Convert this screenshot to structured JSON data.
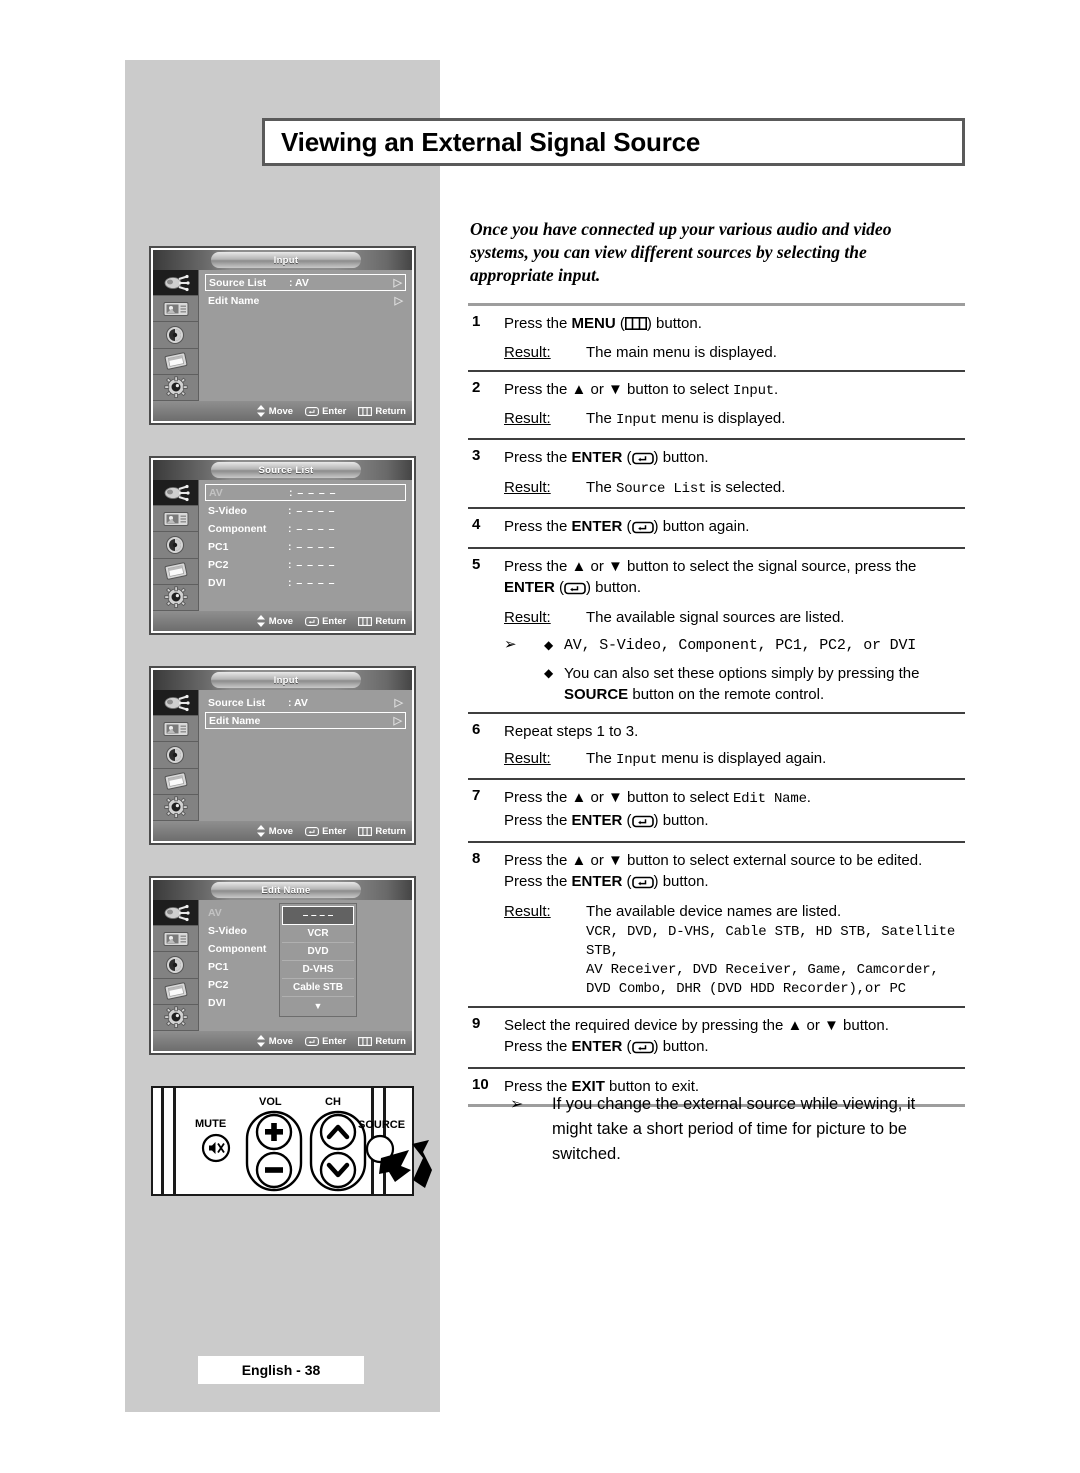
{
  "page": {
    "title": "Viewing an External Signal Source",
    "intro": "Once you have connected up your various audio and video systems, you can view different sources by selecting the appropriate input.",
    "footer": "English - 38"
  },
  "steps": [
    {
      "num": "1",
      "text_a": "Press the ",
      "bold_a": "MENU",
      "text_b": " (",
      "icon": "menu-icon",
      "text_c": ") button.",
      "result_label": "Result:",
      "result_text": "The main menu is displayed."
    },
    {
      "num": "2",
      "text_a": "Press the ▲ or ▼ button to select ",
      "mono_a": "Input",
      "text_c": ".",
      "result_label": "Result:",
      "result_pre": "The ",
      "result_mono": "Input",
      "result_post": " menu is displayed."
    },
    {
      "num": "3",
      "text_a": "Press the ",
      "bold_a": "ENTER",
      "text_b": " (",
      "icon": "enter-icon",
      "text_c": ") button.",
      "result_label": "Result:",
      "result_pre": "The ",
      "result_mono": "Source List",
      "result_post": " is selected."
    },
    {
      "num": "4",
      "text_a": "Press the ",
      "bold_a": "ENTER",
      "text_b": " (",
      "icon": "enter-icon",
      "text_c": ") button again."
    },
    {
      "num": "5",
      "text_a": "Press the ▲ or ▼ button to select the signal source, press the ",
      "bold_a": "ENTER",
      "text_b": " (",
      "icon": "enter-icon",
      "text_c": ") button.",
      "result_label": "Result:",
      "result_text": "The available signal sources are listed.",
      "bullets": [
        {
          "arrow": "➢",
          "diamond": "◆",
          "mono": "AV, S-Video, Component, PC1, PC2, or DVI"
        },
        {
          "arrow": "",
          "diamond": "◆",
          "text_pre": "You can also set these options simply by pressing the ",
          "bold": "SOURCE",
          "text_post": " button on the remote control."
        }
      ]
    },
    {
      "num": "6",
      "text_a": "Repeat steps 1 to 3.",
      "result_label": "Result:",
      "result_pre": "The ",
      "result_mono": "Input",
      "result_post": " menu is displayed again."
    },
    {
      "num": "7",
      "text_a": "Press the ▲ or ▼ button to select ",
      "mono_a": "Edit Name",
      "text_c": ".",
      "line2_a": "Press the ",
      "line2_bold": "ENTER",
      "line2_b": " (",
      "line2_icon": "enter-icon",
      "line2_c": ") button."
    },
    {
      "num": "8",
      "text_a": "Press the ▲ or ▼ button to select external source to be edited.",
      "line2_a": "Press the ",
      "line2_bold": "ENTER",
      "line2_b": " (",
      "line2_icon": "enter-icon",
      "line2_c": ") button.",
      "result_label": "Result:",
      "result_text": "The available device names are listed.",
      "device_lines": [
        "VCR, DVD, D-VHS, Cable STB, HD STB, Satellite STB,",
        "AV Receiver, DVD Receiver, Game, Camcorder,",
        "DVD Combo, DHR (DVD HDD Recorder),or PC"
      ]
    },
    {
      "num": "9",
      "text_a": "Select the required device by pressing the ▲ or ▼ button.",
      "line2_a": "Press the ",
      "line2_bold": "ENTER",
      "line2_b": " (",
      "line2_icon": "enter-icon",
      "line2_c": ") button."
    },
    {
      "num": "10",
      "text_a": "Press the ",
      "bold_a": "EXIT",
      "text_c": " button to exit."
    }
  ],
  "note": {
    "arrow": "➢",
    "text": "If you change the external source while viewing, it might take a short period of time for picture to be switched."
  },
  "osd_footer": {
    "move": "Move",
    "enter": "Enter",
    "return": "Return"
  },
  "osd_icons": [
    "input-plug-icon",
    "picture-icon",
    "sound-speaker-icon",
    "channel-icon",
    "setup-gear-icon"
  ],
  "osd1": {
    "title": "Input",
    "rows": [
      {
        "label": "Source List",
        "value": ": AV",
        "caret": "▷",
        "selected": true
      },
      {
        "label": "Edit Name",
        "value": "",
        "caret": "▷",
        "selected": false
      }
    ]
  },
  "osd2": {
    "title": "Source List",
    "rows": [
      {
        "label": "AV",
        "value": ": – – – –",
        "selected": true,
        "dim": true
      },
      {
        "label": "S-Video",
        "value": ": – – – –",
        "selected": false
      },
      {
        "label": "Component",
        "value": ": – – – –",
        "selected": false
      },
      {
        "label": "PC1",
        "value": ": – – – –",
        "selected": false
      },
      {
        "label": "PC2",
        "value": ": – – – –",
        "selected": false
      },
      {
        "label": "DVI",
        "value": ": – – – –",
        "selected": false
      }
    ]
  },
  "osd3": {
    "title": "Input",
    "rows": [
      {
        "label": "Source List",
        "value": ": AV",
        "caret": "▷",
        "selected": false
      },
      {
        "label": "Edit Name",
        "value": "",
        "caret": "▷",
        "selected": true
      }
    ]
  },
  "osd4": {
    "title": "Edit Name",
    "rows": [
      {
        "label": "AV",
        "value": ":",
        "dim": true
      },
      {
        "label": "S-Video",
        "value": ":"
      },
      {
        "label": "Component",
        "value": ":"
      },
      {
        "label": "PC1",
        "value": ":"
      },
      {
        "label": "PC2",
        "value": ":"
      },
      {
        "label": "DVI",
        "value": ":"
      }
    ],
    "dropdown": [
      {
        "label": "– – – –",
        "selected": true
      },
      {
        "label": "VCR",
        "selected": false
      },
      {
        "label": "DVD",
        "selected": false
      },
      {
        "label": "D-VHS",
        "selected": false
      },
      {
        "label": "Cable STB",
        "selected": false
      },
      {
        "label": "▼",
        "selected": false,
        "arrow": true
      }
    ]
  },
  "remote": {
    "mute_label": "MUTE",
    "vol_label": "VOL",
    "ch_label": "CH",
    "source_label": "SOURCE",
    "mute_icon": "mute-speaker-icon",
    "vol_up_icon": "plus-icon",
    "vol_down_icon": "minus-icon",
    "ch_up_icon": "chevron-up-icon",
    "ch_down_icon": "chevron-down-icon",
    "source_icon": "source-button-icon",
    "pointer_icon": "hand-pointer-icon"
  }
}
